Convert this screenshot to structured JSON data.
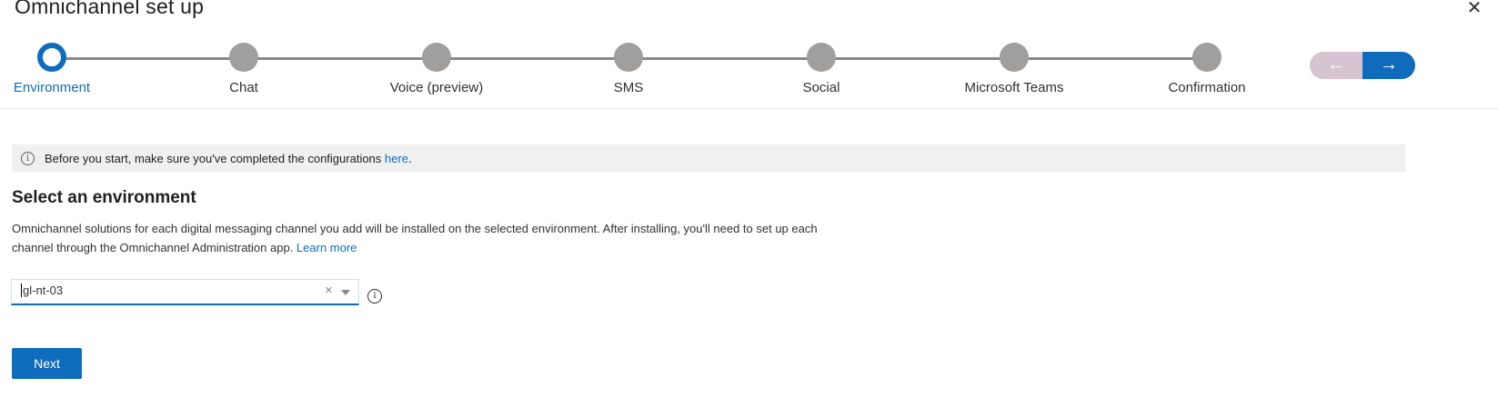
{
  "header": {
    "title": "Omnichannel set up",
    "close_label": "✕"
  },
  "stepper": {
    "steps": [
      {
        "label": "Environment",
        "state": "active"
      },
      {
        "label": "Chat",
        "state": "inactive"
      },
      {
        "label": "Voice (preview)",
        "state": "inactive"
      },
      {
        "label": "SMS",
        "state": "inactive"
      },
      {
        "label": "Social",
        "state": "inactive"
      },
      {
        "label": "Microsoft Teams",
        "state": "inactive"
      },
      {
        "label": "Confirmation",
        "state": "inactive"
      }
    ],
    "prev_arrow": "←",
    "next_arrow": "→"
  },
  "info_bar": {
    "icon": "i",
    "text": "Before you start, make sure you've completed the configurations ",
    "link": "here",
    "suffix": "."
  },
  "section": {
    "title": "Select an environment",
    "description": "Omnichannel solutions for each digital messaging channel you add will be installed on the selected environment. After installing, you'll need to set up each channel through the Omnichannel Administration app. ",
    "learn_more": "Learn more"
  },
  "environment_select": {
    "value": "gl-nt-03",
    "clear_icon": "×",
    "info_icon": "i"
  },
  "actions": {
    "next_label": "Next"
  },
  "colors": {
    "accent": "#0f6cbd",
    "inactive_step": "#a19f9d",
    "info_bar_bg": "#f0f0f0",
    "prev_disabled": "#d6c5d0"
  }
}
